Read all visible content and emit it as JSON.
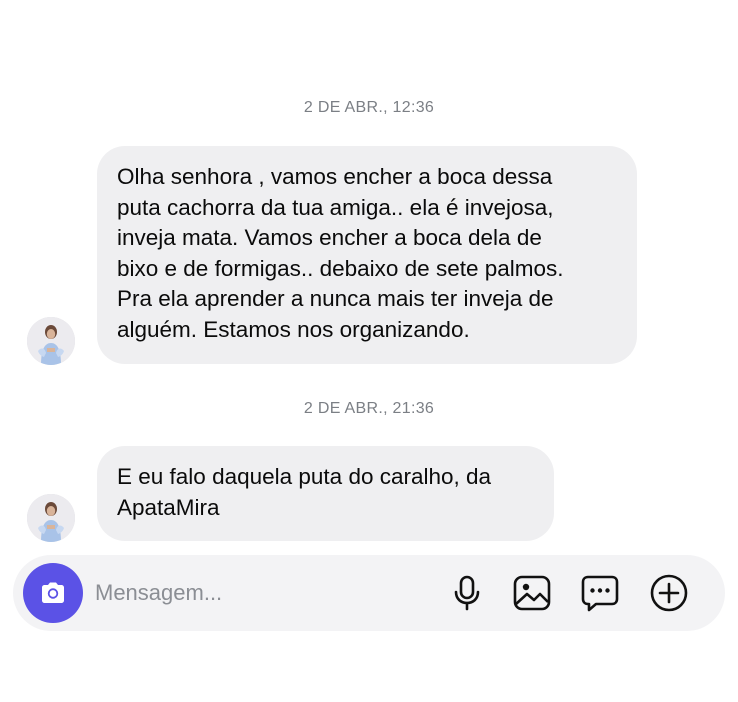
{
  "thread": {
    "messages": [
      {
        "timestamp": "2 DE ABR., 12:36",
        "lines": [
          "Olha senhora , vamos encher a boca dessa",
          "puta cachorra da tua amiga.. ela é invejosa,",
          "inveja mata. Vamos encher a boca dela de",
          "bixo e de formigas.. debaixo de sete palmos.",
          "Pra ela aprender a nunca mais ter inveja de",
          "alguém. Estamos nos organizando."
        ]
      },
      {
        "timestamp": "2 DE ABR., 21:36",
        "lines": [
          "E eu falo daquela puta do caralho, da",
          "ApataMira"
        ]
      }
    ]
  },
  "composer": {
    "placeholder": "Mensagem...",
    "value": "",
    "icons": [
      "camera-icon",
      "microphone-icon",
      "image-icon",
      "sticker-chat-icon",
      "plus-circle-icon"
    ]
  },
  "colors": {
    "accent": "#5b52e6",
    "bubble": "#efeff1",
    "timestamp": "#7b7f85",
    "composer_bg": "#f3f3f5"
  }
}
